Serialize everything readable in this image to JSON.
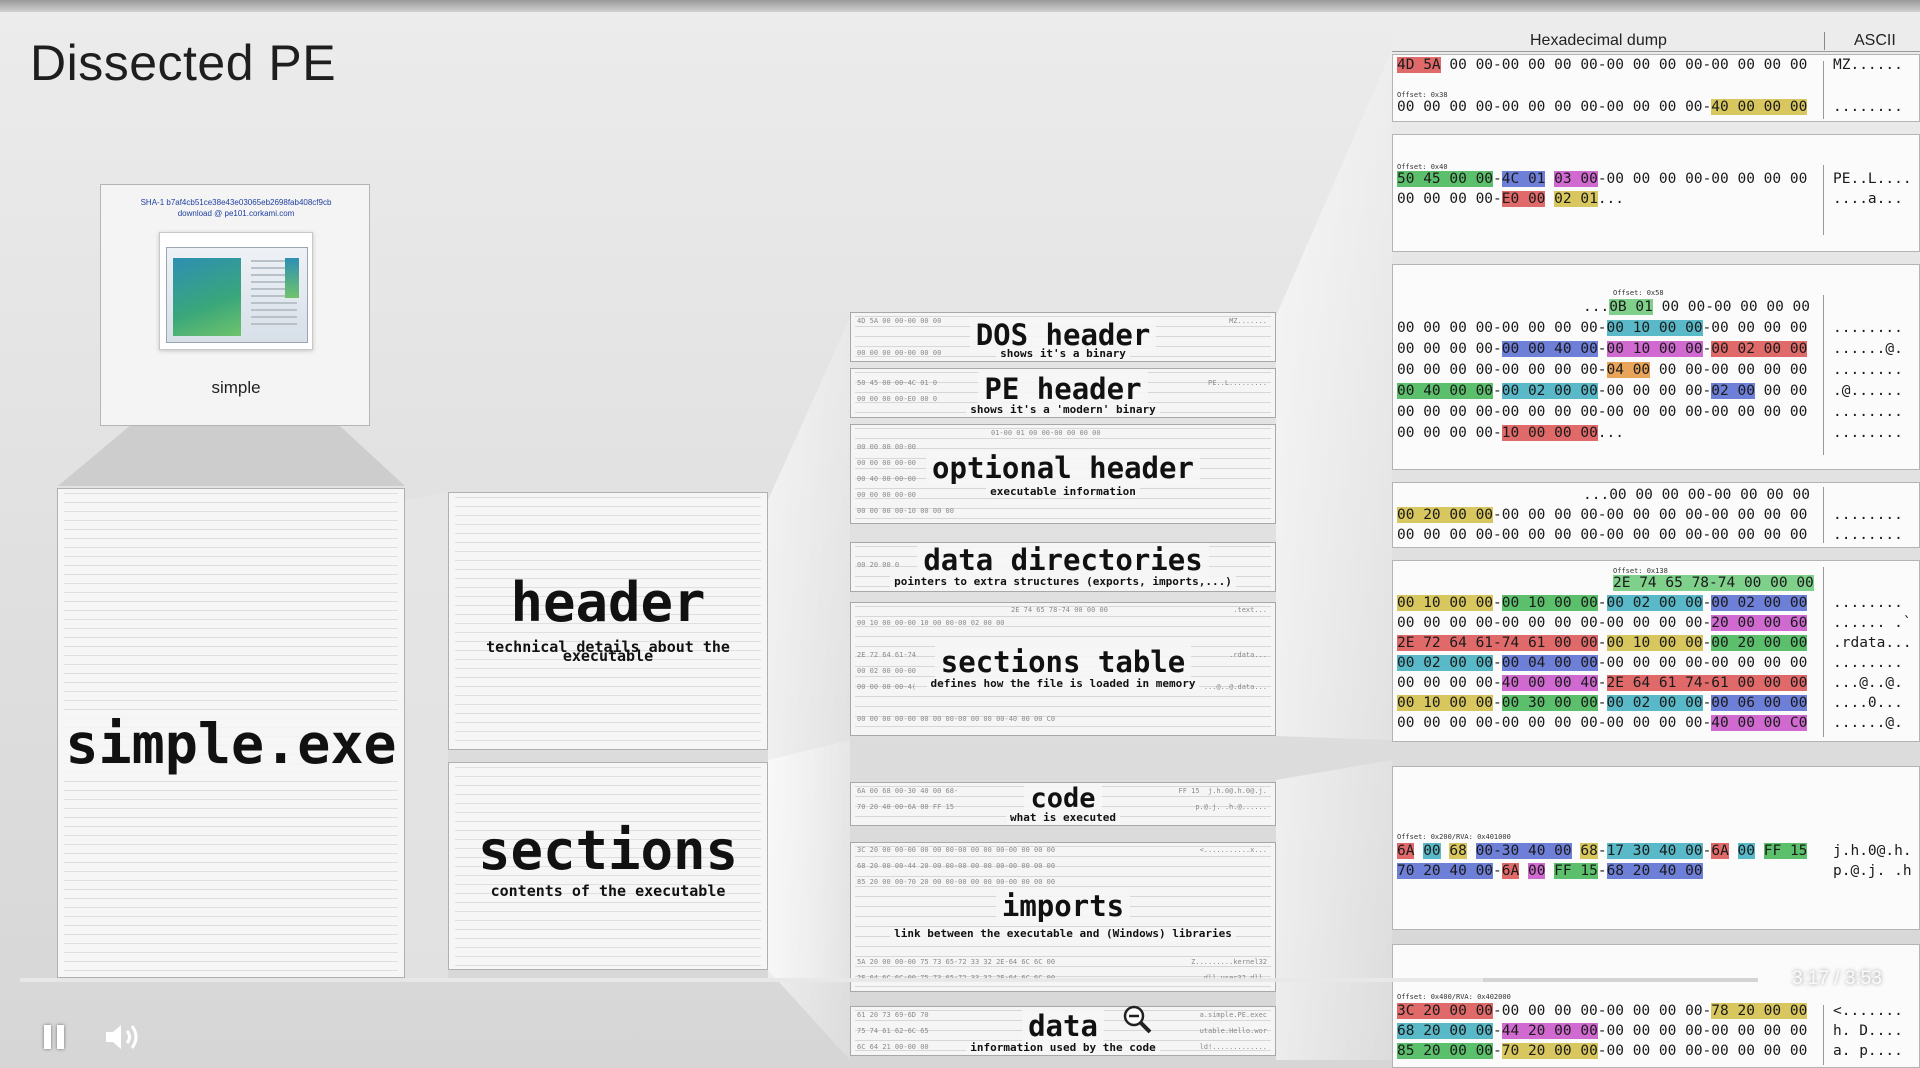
{
  "slide": {
    "title": "Dissected PE"
  },
  "thumbnail": {
    "sha_line1": "SHA-1 b7af4cb51ce38e43e03065eb2698fab408cf9cb",
    "sha_line2": "download @ pe101.corkami.com",
    "label": "simple"
  },
  "file_panel": {
    "label": "simple.exe"
  },
  "parts": {
    "header": {
      "title": "header",
      "subtitle": "technical details about the executable"
    },
    "sections": {
      "title": "sections",
      "subtitle": "contents of the executable"
    }
  },
  "structures": [
    {
      "title": "DOS header",
      "subtitle": "shows it's a binary"
    },
    {
      "title": "PE header",
      "subtitle": "shows it's a 'modern' binary"
    },
    {
      "title": "optional header",
      "subtitle": "executable information"
    },
    {
      "title": "data directories",
      "subtitle": "pointers to extra structures (exports, imports,...)"
    },
    {
      "title": "sections table",
      "subtitle": "defines how the file is loaded in memory"
    },
    {
      "title": "code",
      "subtitle": "what is executed"
    },
    {
      "title": "imports",
      "subtitle": "link between the executable and (Windows) libraries"
    },
    {
      "title": "data",
      "subtitle": "information used by the code"
    }
  ],
  "dump": {
    "header_hex": "Hexadecimal dump",
    "header_ascii": "ASCII",
    "blocks": [
      {
        "offset": "Offset: 0x38",
        "lines": [
          "4D 5A 00 00-00 00 00 00-00 00 00 00-00 00 00 00",
          "00 00 00 00-00 00 00 00-00 00 00 00-40 00 00 00"
        ],
        "ascii": [
          "MZ......",
          "........"
        ]
      },
      {
        "offset": "Offset: 0x40",
        "lines": [
          "50 45 00 00-4C 01 03 00-00 00 00 00-00 00 00 00",
          "00 00 00 00-E0 00 02 01..."
        ],
        "ascii": [
          "PE..L....",
          "....a..."
        ]
      },
      {
        "offset": "Offset: 0x58",
        "lines": [
          "...0B 01 00 00-00 00 00 00",
          "00 00 00 00-00 00 00 00-00 10 00 00-00 00 00 00",
          "00 00 00 00-00 00 40 00-00 10 00 00-00 02 00 00",
          "00 00 00 00-00 00 00 00-04 00 00 00-00 00 00 00",
          "00 40 00 00-00 02 00 00-00 00 00 00-02 00 00 00",
          "00 00 00 00-00 00 00 00-00 00 00 00-00 00 00 00",
          "00 00 00 00-10 00 00 00..."
        ],
        "ascii": [
          "",
          "........",
          "......@.",
          "........",
          ".@......",
          "........",
          "........"
        ]
      },
      {
        "lines": [
          "...00 00 00 00-00 00 00 00",
          "00 20 00 00-00 00 00 00-00 00 00 00-00 00 00 00",
          "00 00 00 00-00 00 00 00-00 00 00 00-00 00 00 00"
        ],
        "ascii": [
          "",
          "........",
          "........"
        ]
      },
      {
        "offset": "Offset: 0x138",
        "lines": [
          "2E 74 65 78-74 00 00 00",
          "00 10 00 00-00 10 00 00-00 02 00 00-00 02 00 00",
          "00 00 00 00-00 00 00 00-00 00 00 00-20 00 00 60",
          "2E 72 64 61-74 61 00 00-00 10 00 00-00 20 00 00",
          "00 02 00 00-00 04 00 00-00 00 00 00-00 00 00 00",
          "00 00 00 00-40 00 00 40-2E 64 61 74-61 00 00 00",
          "00 10 00 00-00 30 00 00-00 02 00 00-00 06 00 00",
          "00 00 00 00-00 00 00 00-00 00 00 00-40 00 00 C0"
        ],
        "ascii": [
          "",
          "........",
          "...... .`",
          ".rdata...",
          "........",
          "...@..@.",
          "....0...",
          "......@."
        ]
      },
      {
        "offset": "Offset: 0x200/RVA: 0x401000",
        "lines": [
          "6A 00 68 00-30 40 00 68-17 30 40 00-6A 00 FF 15",
          "70 20 40 00-6A 00 FF 15-68 20 40 00"
        ],
        "ascii": [
          "j.h.0@.h.",
          "p.@.j. .h"
        ]
      },
      {
        "offset": "Offset: 0x400/RVA: 0x402000",
        "lines": [
          "3C 20 00 00-00 00 00 00-00 00 00 00-78 20 00 00",
          "68 20 00 00-44 20 00 00-00 00 00 00-00 00 00 00",
          "85 20 00 00-70 20 00 00-00 00 00 00-00 00 00 00"
        ],
        "ascii": [
          "<.......",
          "h. D....",
          "a. p...."
        ]
      }
    ]
  },
  "player": {
    "time": "3:17 / 3:53",
    "progress": 0.842,
    "pause_icon": "pause-icon",
    "volume_icon": "volume-icon"
  }
}
